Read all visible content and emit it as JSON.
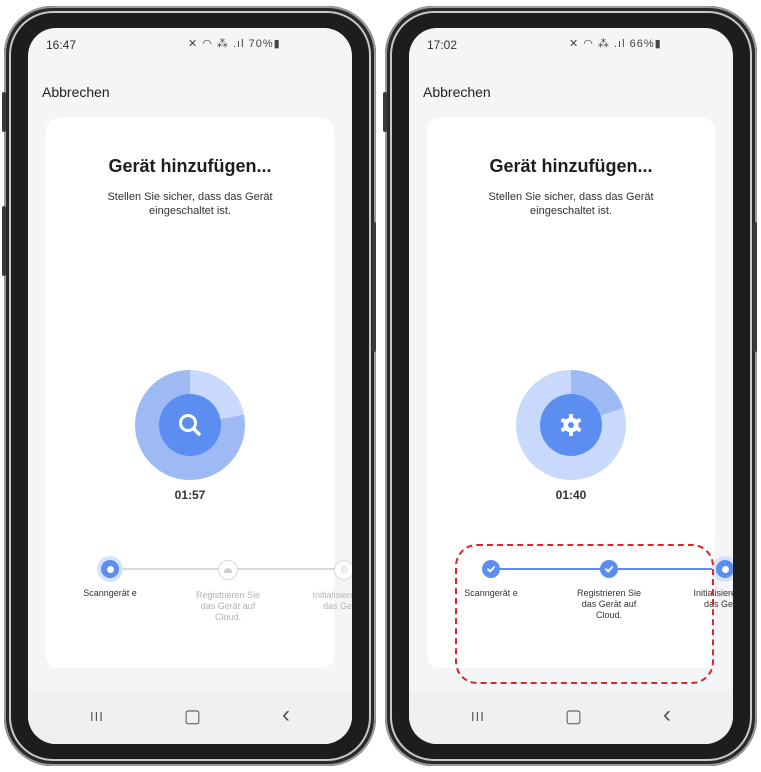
{
  "phones": [
    {
      "status": {
        "time": "16:47",
        "icons": "✕ ◠ ⁂ .ıl 70%▮"
      },
      "cancel_label": "Abbrechen",
      "title": "Gerät hinzufügen...",
      "subtitle": "Stellen Sie sicher, dass das Gerät eingeschaltet ist.",
      "center_icon": "search-icon",
      "timer": "01:57",
      "steps": [
        {
          "label": "Scanngerät e",
          "state": "active"
        },
        {
          "label": "Registrieren Sie das Gerät auf Cloud.",
          "state": "pending"
        },
        {
          "label": "Initialisieren Sie das Gerät.",
          "state": "pending"
        }
      ],
      "nav": {
        "recent": "III",
        "home": "▢",
        "back": "‹"
      }
    },
    {
      "status": {
        "time": "17:02",
        "icons": "✕ ◠ ⁂ .ıl 66%▮"
      },
      "cancel_label": "Abbrechen",
      "title": "Gerät hinzufügen...",
      "subtitle": "Stellen Sie sicher, dass das Gerät eingeschaltet ist.",
      "center_icon": "gear-icon",
      "timer": "01:40",
      "steps": [
        {
          "label": "Scanngerät e",
          "state": "done"
        },
        {
          "label": "Registrieren Sie das Gerät auf Cloud.",
          "state": "done"
        },
        {
          "label": "Initialisieren Sie das Gerät.",
          "state": "active"
        }
      ],
      "nav": {
        "recent": "III",
        "home": "▢",
        "back": "‹"
      }
    }
  ],
  "colors": {
    "accent": "#5b8ef0",
    "ring_light": "#c9d9fb",
    "ring_mid": "#9dbaf5",
    "pending": "#d9d9d9",
    "highlight": "#e0242b"
  }
}
